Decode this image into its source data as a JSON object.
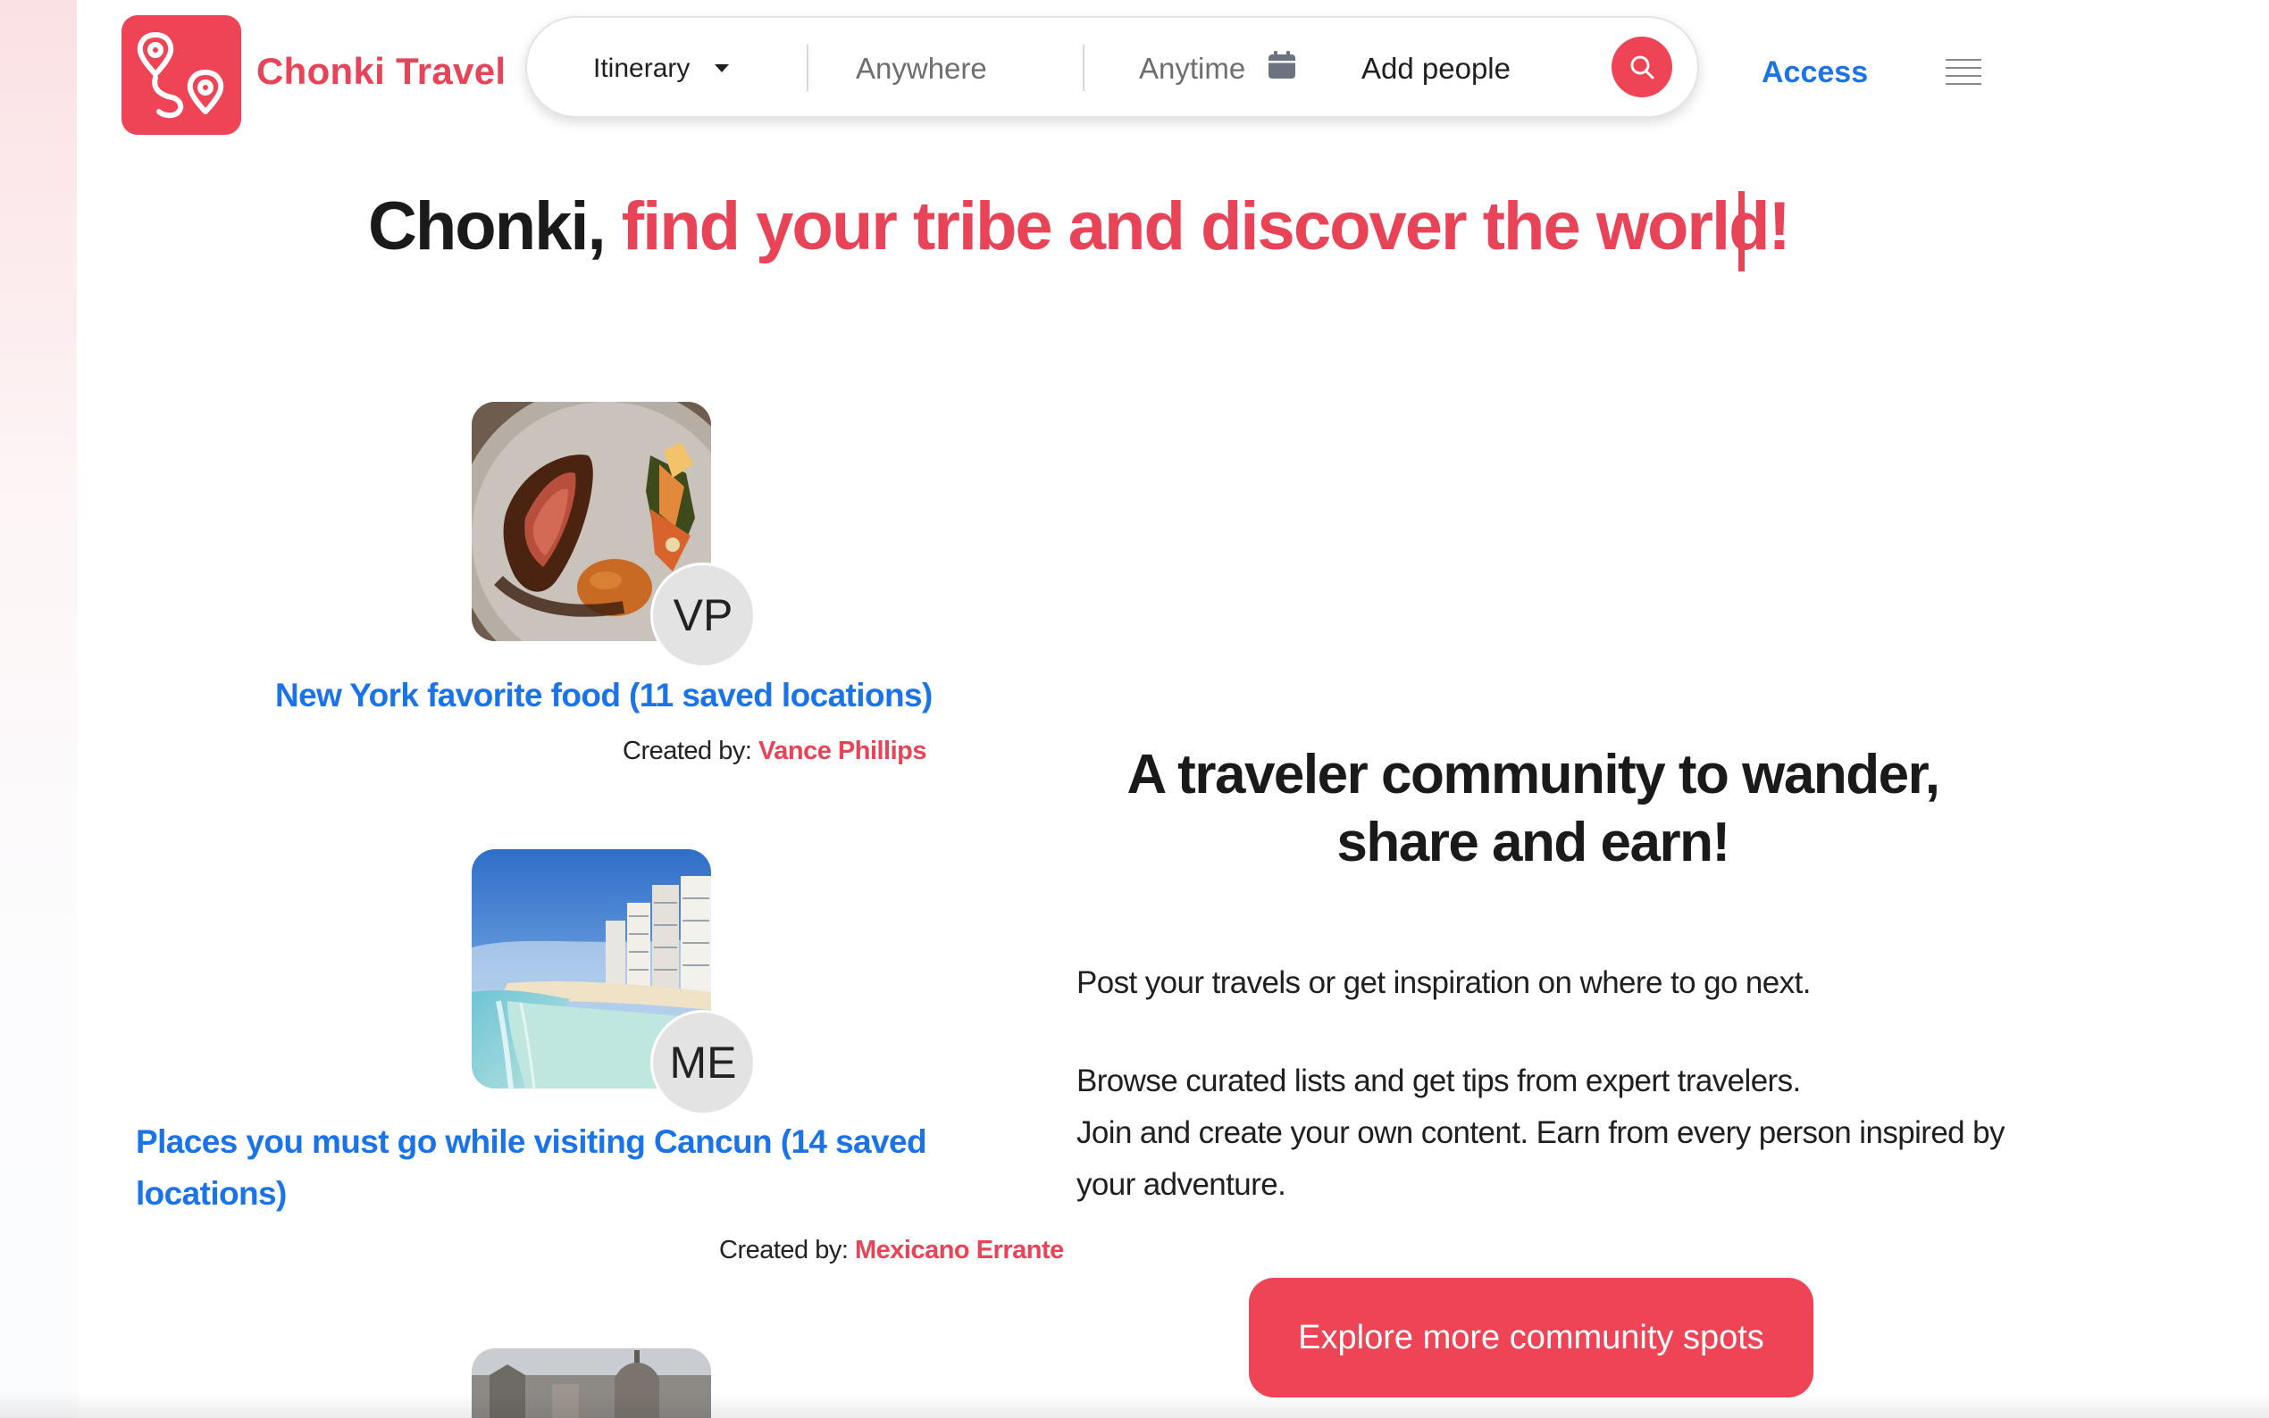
{
  "app": {
    "brand": "Chonki Travel"
  },
  "search": {
    "itinerary_label": "Itinerary",
    "anywhere_label": "Anywhere",
    "anytime_label": "Anytime",
    "people_label": "Add people"
  },
  "nav": {
    "access_label": "Access"
  },
  "hero": {
    "prefix": "Chonki, ",
    "accent": "find your tribe and discover the world!"
  },
  "cards": [
    {
      "avatar_initials": "VP",
      "title": "New York favorite food (11 saved locations)",
      "created_label": "Created by: ",
      "author": "Vance Phillips"
    },
    {
      "avatar_initials": "ME",
      "title": "Places you must go while visiting Cancun (14 saved locations)",
      "created_label": "Created by: ",
      "author": "Mexicano Errante"
    }
  ],
  "community": {
    "heading": "A traveler community to wander, share and earn!",
    "p1": "Post your travels or get inspiration on where to go next.",
    "p2": "Browse curated lists and get tips from expert travelers.",
    "p3": "Join and create your own content. Earn from every person inspired by your adventure.",
    "cta_label": "Explore more community spots"
  },
  "colors": {
    "brand_red": "#ef4456",
    "link_blue": "#1a73e8"
  },
  "icons": {
    "logo": "map-route-pins-icon",
    "caret": "caret-down-icon",
    "calendar": "calendar-icon",
    "search": "search-icon",
    "menu": "hamburger-menu-icon"
  }
}
